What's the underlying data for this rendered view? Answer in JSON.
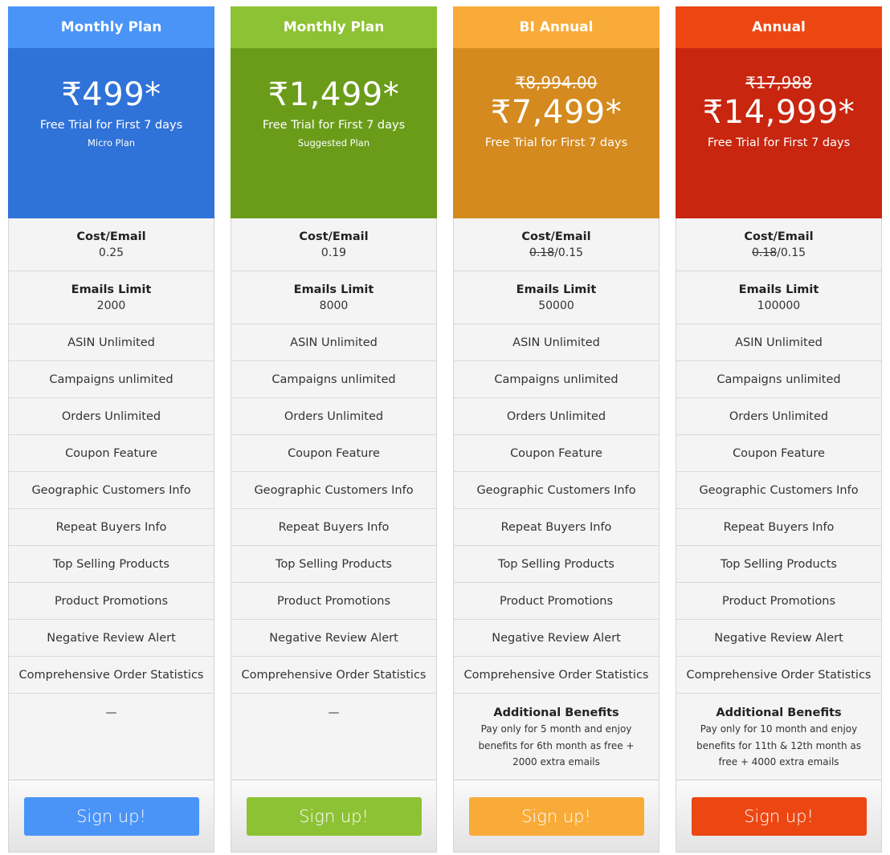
{
  "plans": [
    {
      "header": "Monthly Plan",
      "header_color": "#4a94f7",
      "price_color": "#2f72d8",
      "button_color": "#4a94f7",
      "old_price": null,
      "price": "₹499*",
      "trial": "Free Trial for First 7 days",
      "subtitle": "Micro Plan",
      "cost_label": "Cost/Email",
      "cost_old": "",
      "cost_value": "0.25",
      "limit_label": "Emails Limit",
      "limit_value": "2000",
      "features": [
        "ASIN Unlimited",
        "Campaigns unlimited",
        "Orders Unlimited",
        "Coupon Feature",
        "Geographic Customers Info",
        "Repeat Buyers Info",
        "Top Selling Products",
        "Product Promotions",
        "Negative Review Alert",
        "Comprehensive Order Statistics"
      ],
      "extra_title": null,
      "extra_text": "—",
      "button": "Sign up!"
    },
    {
      "header": "Monthly Plan",
      "header_color": "#8dc234",
      "price_color": "#6a9c1a",
      "button_color": "#8dc234",
      "old_price": null,
      "price": "₹1,499*",
      "trial": "Free Trial for First 7 days",
      "subtitle": "Suggested Plan",
      "cost_label": "Cost/Email",
      "cost_old": "",
      "cost_value": "0.19",
      "limit_label": "Emails Limit",
      "limit_value": "8000",
      "features": [
        "ASIN Unlimited",
        "Campaigns unlimited",
        "Orders Unlimited",
        "Coupon Feature",
        "Geographic Customers Info",
        "Repeat Buyers Info",
        "Top Selling Products",
        "Product Promotions",
        "Negative Review Alert",
        "Comprehensive Order Statistics"
      ],
      "extra_title": null,
      "extra_text": "—",
      "button": "Sign up!"
    },
    {
      "header": "BI Annual",
      "header_color": "#f8ab38",
      "price_color": "#d48a1e",
      "button_color": "#f8ab38",
      "old_price": "₹8,994.00",
      "price": "₹7,499*",
      "trial": "Free Trial for First 7 days",
      "subtitle": null,
      "cost_label": "Cost/Email",
      "cost_old": "0.18",
      "cost_value": "/0.15",
      "limit_label": "Emails Limit",
      "limit_value": "50000",
      "features": [
        "ASIN Unlimited",
        "Campaigns unlimited",
        "Orders Unlimited",
        "Coupon Feature",
        "Geographic Customers Info",
        "Repeat Buyers Info",
        "Top Selling Products",
        "Product Promotions",
        "Negative Review Alert",
        "Comprehensive Order Statistics"
      ],
      "extra_title": "Additional Benefits",
      "extra_text": "Pay only for 5 month and enjoy benefits for 6th month as free + 2000 extra emails",
      "button": "Sign up!"
    },
    {
      "header": "Annual",
      "header_color": "#ec4713",
      "price_color": "#c8260f",
      "button_color": "#ec4713",
      "old_price": "₹17,988",
      "price": "₹14,999*",
      "trial": "Free Trial for First  7 days",
      "subtitle": null,
      "cost_label": "Cost/Email",
      "cost_old": "0.18",
      "cost_value": "/0.15",
      "limit_label": "Emails Limit",
      "limit_value": "100000",
      "features": [
        "ASIN Unlimited",
        "Campaigns unlimited",
        "Orders Unlimited",
        "Coupon Feature",
        "Geographic Customers Info",
        "Repeat Buyers Info",
        "Top Selling Products",
        "Product Promotions",
        "Negative Review Alert",
        "Comprehensive Order Statistics"
      ],
      "extra_title": "Additional Benefits",
      "extra_text": "Pay only for 10 month  and enjoy benefits for 11th & 12th month as free + 4000 extra emails",
      "button": "Sign up!"
    }
  ]
}
